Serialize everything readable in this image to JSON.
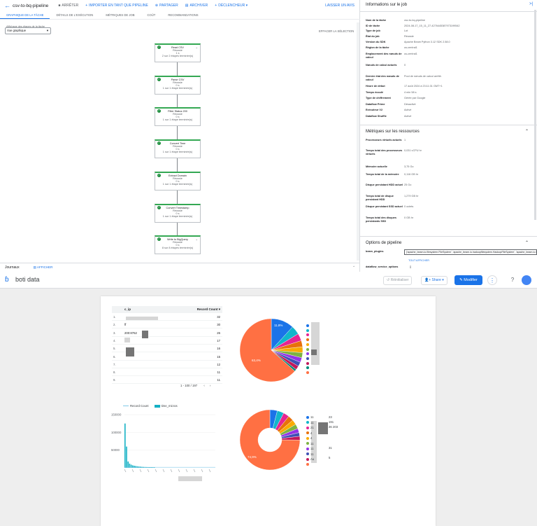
{
  "dataflow": {
    "job_name": "csv-to-bq-pipeline",
    "actions": [
      {
        "icon": "stop-icon",
        "label": "ARRÊTER"
      },
      {
        "icon": "plus-icon",
        "label": "IMPORTER EN TANT QUE PIPELINE"
      },
      {
        "icon": "share-icon",
        "label": "PARTAGER"
      },
      {
        "icon": "archive-icon",
        "label": "ARCHIVER"
      },
      {
        "icon": "plus-icon",
        "label": "DÉCLENCHEUR ▾"
      }
    ],
    "feedback_label": "LAISSER UN AVIS",
    "tabs": [
      "GRAPHIQUE DE LA TÂCHE",
      "DÉTAILS DE L'EXÉCUTION",
      "MÉTRIQUES DE JOB",
      "COÛT",
      "RECOMMANDATIONS"
    ],
    "graph_display_label": "Affichage des étapes de la tâche",
    "graph_display_value": "Vue graphique",
    "clear_selection": "EFFACER LA SÉLECTION",
    "steps": [
      {
        "name": "Read CSV",
        "status": "Réussie",
        "time": "1 s",
        "steps": "2 sur 2 étapes terminée(s)"
      },
      {
        "name": "Parse CSV",
        "status": "Réussie",
        "time": "0 s",
        "steps": "1 sur 1 étape terminée(s)"
      },
      {
        "name": "Filter Status 200",
        "status": "Réussie",
        "time": "0 s",
        "steps": "1 sur 1 étape terminée(s)"
      },
      {
        "name": "Convert Time",
        "status": "Réussie",
        "time": "0 s",
        "steps": "1 sur 1 étape terminée(s)"
      },
      {
        "name": "Extract Domain",
        "status": "Réussie",
        "time": "0 s",
        "steps": "1 sur 1 étape terminée(s)"
      },
      {
        "name": "Convert Timestamp",
        "status": "Réussie",
        "time": "0 s",
        "steps": "1 sur 1 étape terminée(s)"
      },
      {
        "name": "Write to BigQuery",
        "status": "Réussie",
        "time": "0 s",
        "steps": "8 sur 8 étapes terminée(s)"
      }
    ],
    "logs_title": "Journaux",
    "logs_show": "AFFICHER"
  },
  "info_panel": {
    "title": "Informations sur le job",
    "rows": [
      {
        "k": "Nom de la tâche",
        "v": "csv-to-bq-pipeline"
      },
      {
        "k": "ID de tâche",
        "v": "2024-08-17_15_11_27-4276445387973199542"
      },
      {
        "k": "Type de job",
        "v": "Lot"
      },
      {
        "k": "État du job",
        "v": "Réussie"
      },
      {
        "k": "Version du SDK",
        "v": "Apache Beam Python 3.12 SDK 2.58.0"
      },
      {
        "k": "Région de la tâche",
        "v": "us-central1"
      },
      {
        "k": "Emplacement des nœuds de calcul",
        "v": "us-central1"
      },
      {
        "k": "Nœuds de calcul actuels",
        "v": "0"
      },
      {
        "k": "Dernier état des nœuds de calcul",
        "v": "Pool de nœuds de calcul arrêté."
      },
      {
        "k": "Heure de début",
        "v": "17 août 2024 à 23:11:31 GMT+1"
      },
      {
        "k": "Temps écoulé",
        "v": "4 min 58 s"
      },
      {
        "k": "Type de chiffrement",
        "v": "Gérée par Google"
      },
      {
        "k": "Dataflow Prime",
        "v": "Désactivé"
      },
      {
        "k": "Exécuteur V2",
        "v": "Activé"
      },
      {
        "k": "Dataflow Shuffle",
        "v": "Activé"
      }
    ],
    "resources_title": "Métriques sur les ressources",
    "resources": [
      {
        "k": "Processeurs virtuels actuels",
        "v": "1"
      },
      {
        "k": "Temps total des processeurs virtuels",
        "v": "0,031 vCPU hr"
      },
      {
        "k": "Mémoire actuelle",
        "v": "3,75 Go"
      },
      {
        "k": "Temps total de la mémoire",
        "v": "0,116 GB hr"
      },
      {
        "k": "Disque persistant HDD actuel",
        "v": "25 Go"
      },
      {
        "k": "Temps total de disque persistant HDD",
        "v": "1,279 GB hr"
      },
      {
        "k": "Disque persistant SSD actuel",
        "v": "0 octets"
      },
      {
        "k": "Temps total des disques persistants SSD",
        "v": "0 GB hr"
      }
    ],
    "pipeline_title": "Options de pipeline",
    "beam_plugins_key": "beam_plugins",
    "beam_plugins_value": "['apache_beam.io.filesystem.FileSystem', 'apache_beam.io.hadoopfilesystem.HadoopFileSystem', 'apache_beam.io.localfilesystem.LocalFileSystem', 'apache_beam.io.gcp.gcsfilesystem.GCSFileSystem']",
    "show_all": "TOUT AFFICHER",
    "service_options_key": "dataflow_service_options",
    "service_options_value": "[]"
  },
  "looker": {
    "report_title": "boti data",
    "reset_label": "Réinitialiser",
    "share_label": "Share",
    "edit_label": "Modifier",
    "table": {
      "col_ip": "c_ip",
      "col_count": "Record Count ▾",
      "rows": [
        {
          "i": "1.",
          "ip": "",
          "c": "32"
        },
        {
          "i": "2.",
          "ip": "ff",
          "c": "30"
        },
        {
          "i": "3.",
          "ip": "200:8762",
          "c": "26"
        },
        {
          "i": "4.",
          "ip": "",
          "c": "17"
        },
        {
          "i": "5.",
          "ip": "",
          "c": "16"
        },
        {
          "i": "6.",
          "ip": "",
          "c": "15"
        },
        {
          "i": "7.",
          "ip": "",
          "c": "12"
        },
        {
          "i": "8.",
          "ip": "",
          "c": "11"
        },
        {
          "i": "9.",
          "ip": "",
          "c": "11"
        }
      ],
      "pager": "1 - 100 / 197"
    },
    "pie1_labels": {
      "big": "63,4%",
      "small": "11,8%"
    },
    "pie2_labels": {
      "big": "74,9%"
    },
    "pie2_legend": [
      "11",
      "11",
      "21",
      "4",
      "4",
      "11",
      "11",
      "11",
      "Au"
    ],
    "pie2_legend_values": [
      "23",
      "191",
      "36 203",
      "31",
      "5"
    ],
    "bar_legend": [
      "Record Count",
      "time_micros"
    ],
    "bar_yticks": [
      "150000",
      "100000",
      "50000"
    ]
  },
  "chart_data": [
    {
      "type": "pie",
      "title": "",
      "values": [
        11.8,
        4.5,
        3.8,
        3.2,
        3.0,
        2.6,
        2.4,
        2.2,
        2.0,
        1.1,
        63.4
      ],
      "colors": [
        "#1a73e8",
        "#12b5cb",
        "#e52592",
        "#e8710a",
        "#f9ab00",
        "#7cb342",
        "#9334e6",
        "#3f51b5",
        "#c2185b",
        "#00897b",
        "#ff7043"
      ]
    },
    {
      "type": "pie",
      "donut": true,
      "title": "",
      "values": [
        4.0,
        3.6,
        3.2,
        2.9,
        2.7,
        2.5,
        2.2,
        2.0,
        2.0,
        74.9
      ],
      "colors": [
        "#1a73e8",
        "#12b5cb",
        "#e52592",
        "#e8710a",
        "#f9ab00",
        "#7cb342",
        "#9334e6",
        "#3f51b5",
        "#c2185b",
        "#ff7043"
      ]
    },
    {
      "type": "bar",
      "series": [
        {
          "name": "Record Count",
          "values": [
            1,
            1,
            1,
            1,
            1,
            1,
            1,
            1,
            1,
            1,
            1,
            1,
            1,
            1,
            1,
            1,
            1,
            1,
            1,
            1
          ]
        },
        {
          "name": "time_micros",
          "values": [
            125000,
            60000,
            18000,
            12000,
            9000,
            7000,
            6000,
            5200,
            4500,
            4000,
            3500,
            3000,
            2700,
            2400,
            2200,
            2000,
            1800,
            1600,
            1500,
            1400
          ]
        }
      ],
      "ylim": [
        0,
        150000
      ]
    }
  ]
}
